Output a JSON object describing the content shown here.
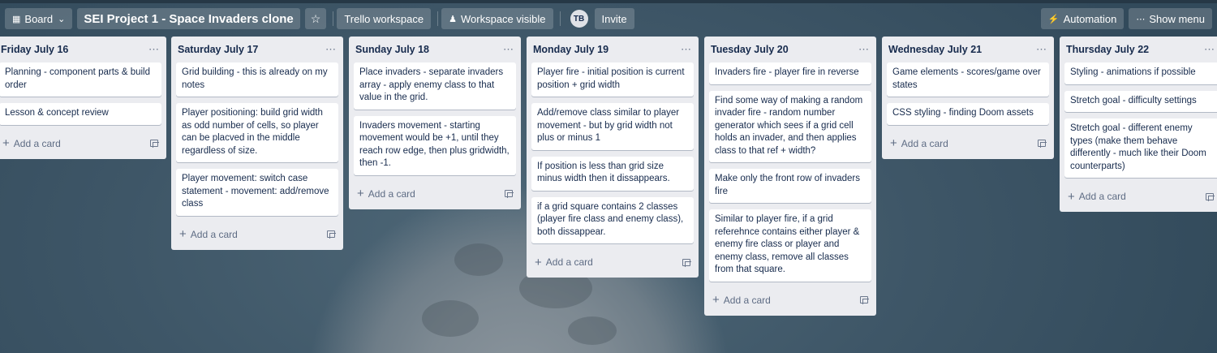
{
  "header": {
    "board_view": "Board",
    "board_title": "SEI Project 1 - Space Invaders clone",
    "workspace": "Trello workspace",
    "visibility": "Workspace visible",
    "avatar_initials": "TB",
    "invite": "Invite",
    "automation": "Automation",
    "show_menu": "Show menu"
  },
  "add_card_label": "Add a card",
  "lists": [
    {
      "title": "Friday July 16",
      "cards": [
        "Planning - component parts & build order",
        "Lesson & concept review"
      ]
    },
    {
      "title": "Saturday July 17",
      "cards": [
        "Grid building - this is already on my notes",
        "Player positioning: build grid width as odd number of cells, so player can be placved in the middle regardless of size.",
        "Player movement: switch case statement - movement: add/remove class"
      ]
    },
    {
      "title": "Sunday July 18",
      "cards": [
        "Place invaders - separate invaders array - apply enemy class to that value in the grid.",
        "Invaders movement - starting movement would be +1, until they reach row edge, then plus gridwidth, then -1."
      ]
    },
    {
      "title": "Monday July 19",
      "cards": [
        "Player fire - initial position is current position + grid width",
        "Add/remove class similar to player movement - but by grid width not plus or minus 1",
        "If position is less than grid size minus width then it dissappears.",
        "if a grid square contains 2 classes (player fire class and enemy class), both dissappear."
      ]
    },
    {
      "title": "Tuesday July 20",
      "cards": [
        "Invaders fire - player fire in reverse",
        "Find some way of making a random invader fire - random number generator which sees if a grid cell holds an invader, and then applies class to that ref + width?",
        "Make only the front row of invaders fire",
        "Similar to player fire, if a grid referehnce contains either player & enemy fire class or player and enemy class, remove all classes from that square."
      ]
    },
    {
      "title": "Wednesday July 21",
      "cards": [
        "Game elements - scores/game over states",
        "CSS styling - finding Doom assets"
      ]
    },
    {
      "title": "Thursday July 22",
      "cards": [
        "Styling - animations if possible",
        "Stretch goal - difficulty settings",
        "Stretch goal - different enemy types (make them behave differently - much like their Doom counterparts)"
      ]
    }
  ]
}
